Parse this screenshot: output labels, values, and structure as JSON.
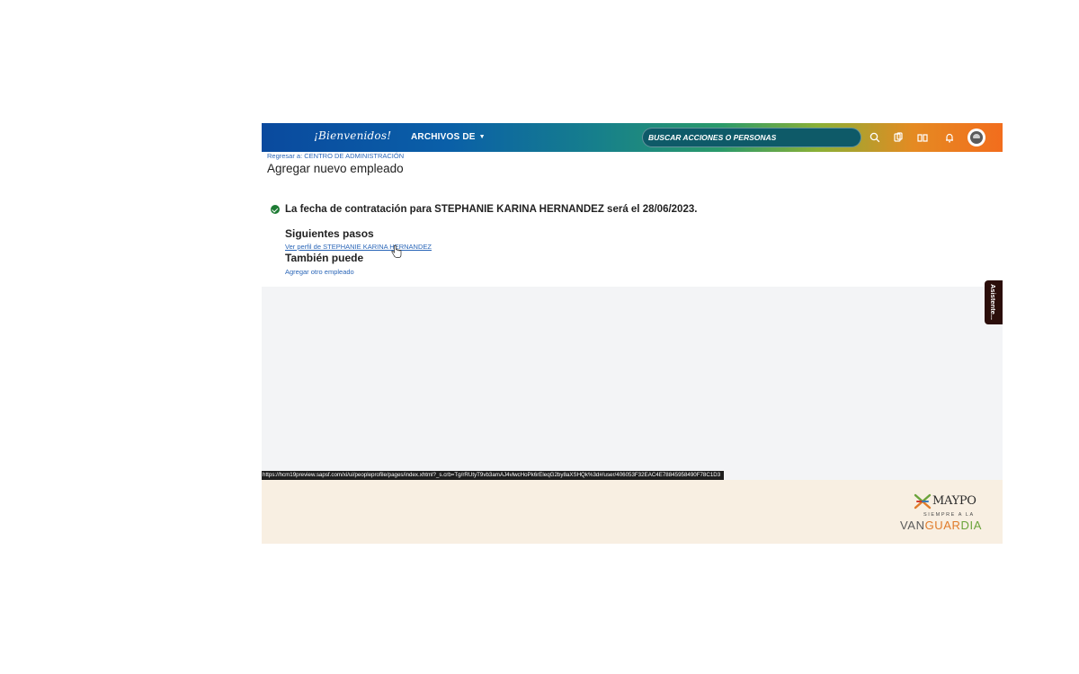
{
  "header": {
    "logo_text": "¡Bienvenidos!",
    "archivos_label": "ARCHIVOS DE",
    "search_placeholder": "BUSCAR ACCIONES O PERSONAS",
    "icons": [
      "search-icon",
      "docs-icon",
      "book-icon",
      "bell-icon",
      "avatar"
    ]
  },
  "breadcrumb": {
    "back_label": "Regresar a: CENTRO DE ADMINISTRACIÓN"
  },
  "page": {
    "title": "Agregar nuevo empleado",
    "success_message": "La fecha de contratación para STEPHANIE KARINA HERNANDEZ será el 28/06/2023.",
    "next_steps_title": "Siguientes pasos",
    "next_steps_link": "Ver perfil de STEPHANIE KARINA HERNANDEZ",
    "also_title": "También puede",
    "also_link": "Agregar otro empleado"
  },
  "side_tab": {
    "label": "Asistente..."
  },
  "status_bar": {
    "url": "https://hcm19preview.sapsf.com/xi/ui/peopleprofile/pages/index.xhtml?_s.crb=Tg/rRUtyT9vb3amAJ4vlwcHoPk6rEleqG2by8aXSHQk%3d#/user/406053F32EAC4E78845958490F78C1D3"
  },
  "footer": {
    "brand": "MAYPO",
    "tagline": "SIEMPRE A LA",
    "slogan_part1": "VAN",
    "slogan_part2": "GUAR",
    "slogan_part3": "DIA"
  },
  "colors": {
    "header_gradient_start": "#0a4a9e",
    "header_gradient_end": "#f26d1d",
    "link": "#2a66b8",
    "success_check": "#1e7b34",
    "footer_bg": "#f8efe2"
  }
}
